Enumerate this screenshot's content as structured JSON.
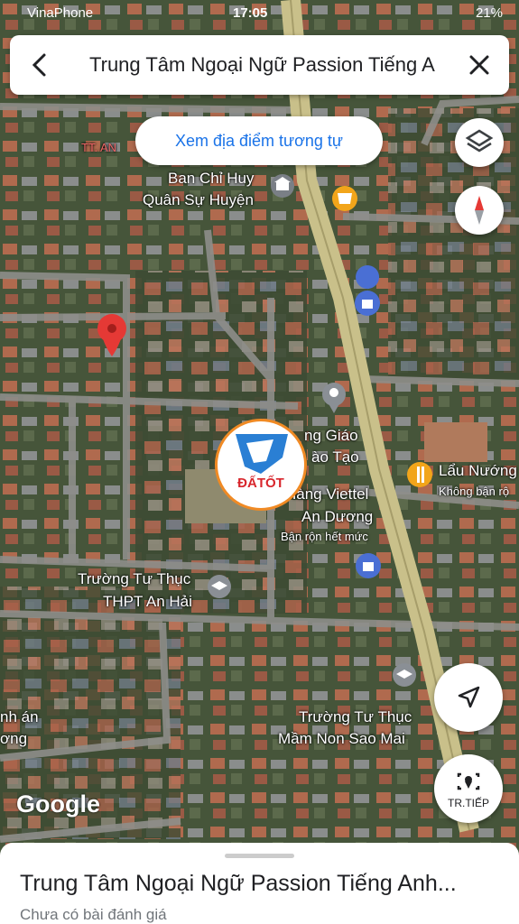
{
  "status_bar": {
    "carrier": "VinaPhone",
    "time": "17:05",
    "battery": "21%"
  },
  "search": {
    "query": "Trung Tâm Ngoại Ngữ Passion Tiếng A"
  },
  "similar_button": {
    "label": "Xem địa điểm tương tự"
  },
  "map_labels": {
    "ban_chi_huy_1": "Ban Chỉ Huy",
    "ban_chi_huy_2": "Quân Sự Huyện",
    "tt_an": "TT. AN",
    "giao_duc_1": "ng Giáo",
    "giao_duc_2": "ào Tạo",
    "viettel_1": "Hàng Viettel",
    "viettel_2": "An Dương",
    "viettel_3": "Bận rộn hết mức",
    "lau_1": "Lẩu Nướng",
    "lau_2": "Không bận rộ",
    "thpt_1": "Trường Tư Thục",
    "thpt_2": "THPT An Hải",
    "mn_1": "Trường Tư Thục",
    "mn_2": "Mầm Non Sao Mai",
    "left_1": "nh án",
    "left_2": "ơng"
  },
  "watermark": {
    "brand": "ĐẤTỐT"
  },
  "attribution": "Google",
  "route_button": {
    "label": "TR.TIẾP"
  },
  "sheet": {
    "title": "Trung Tâm Ngoại Ngữ Passion Tiếng Anh...",
    "subtitle": "Chưa có bài đánh giá"
  },
  "colors": {
    "accent": "#1a73e8",
    "pin": "#e53935",
    "road_main": "#c9c08a",
    "road_minor": "#8a8a86"
  }
}
